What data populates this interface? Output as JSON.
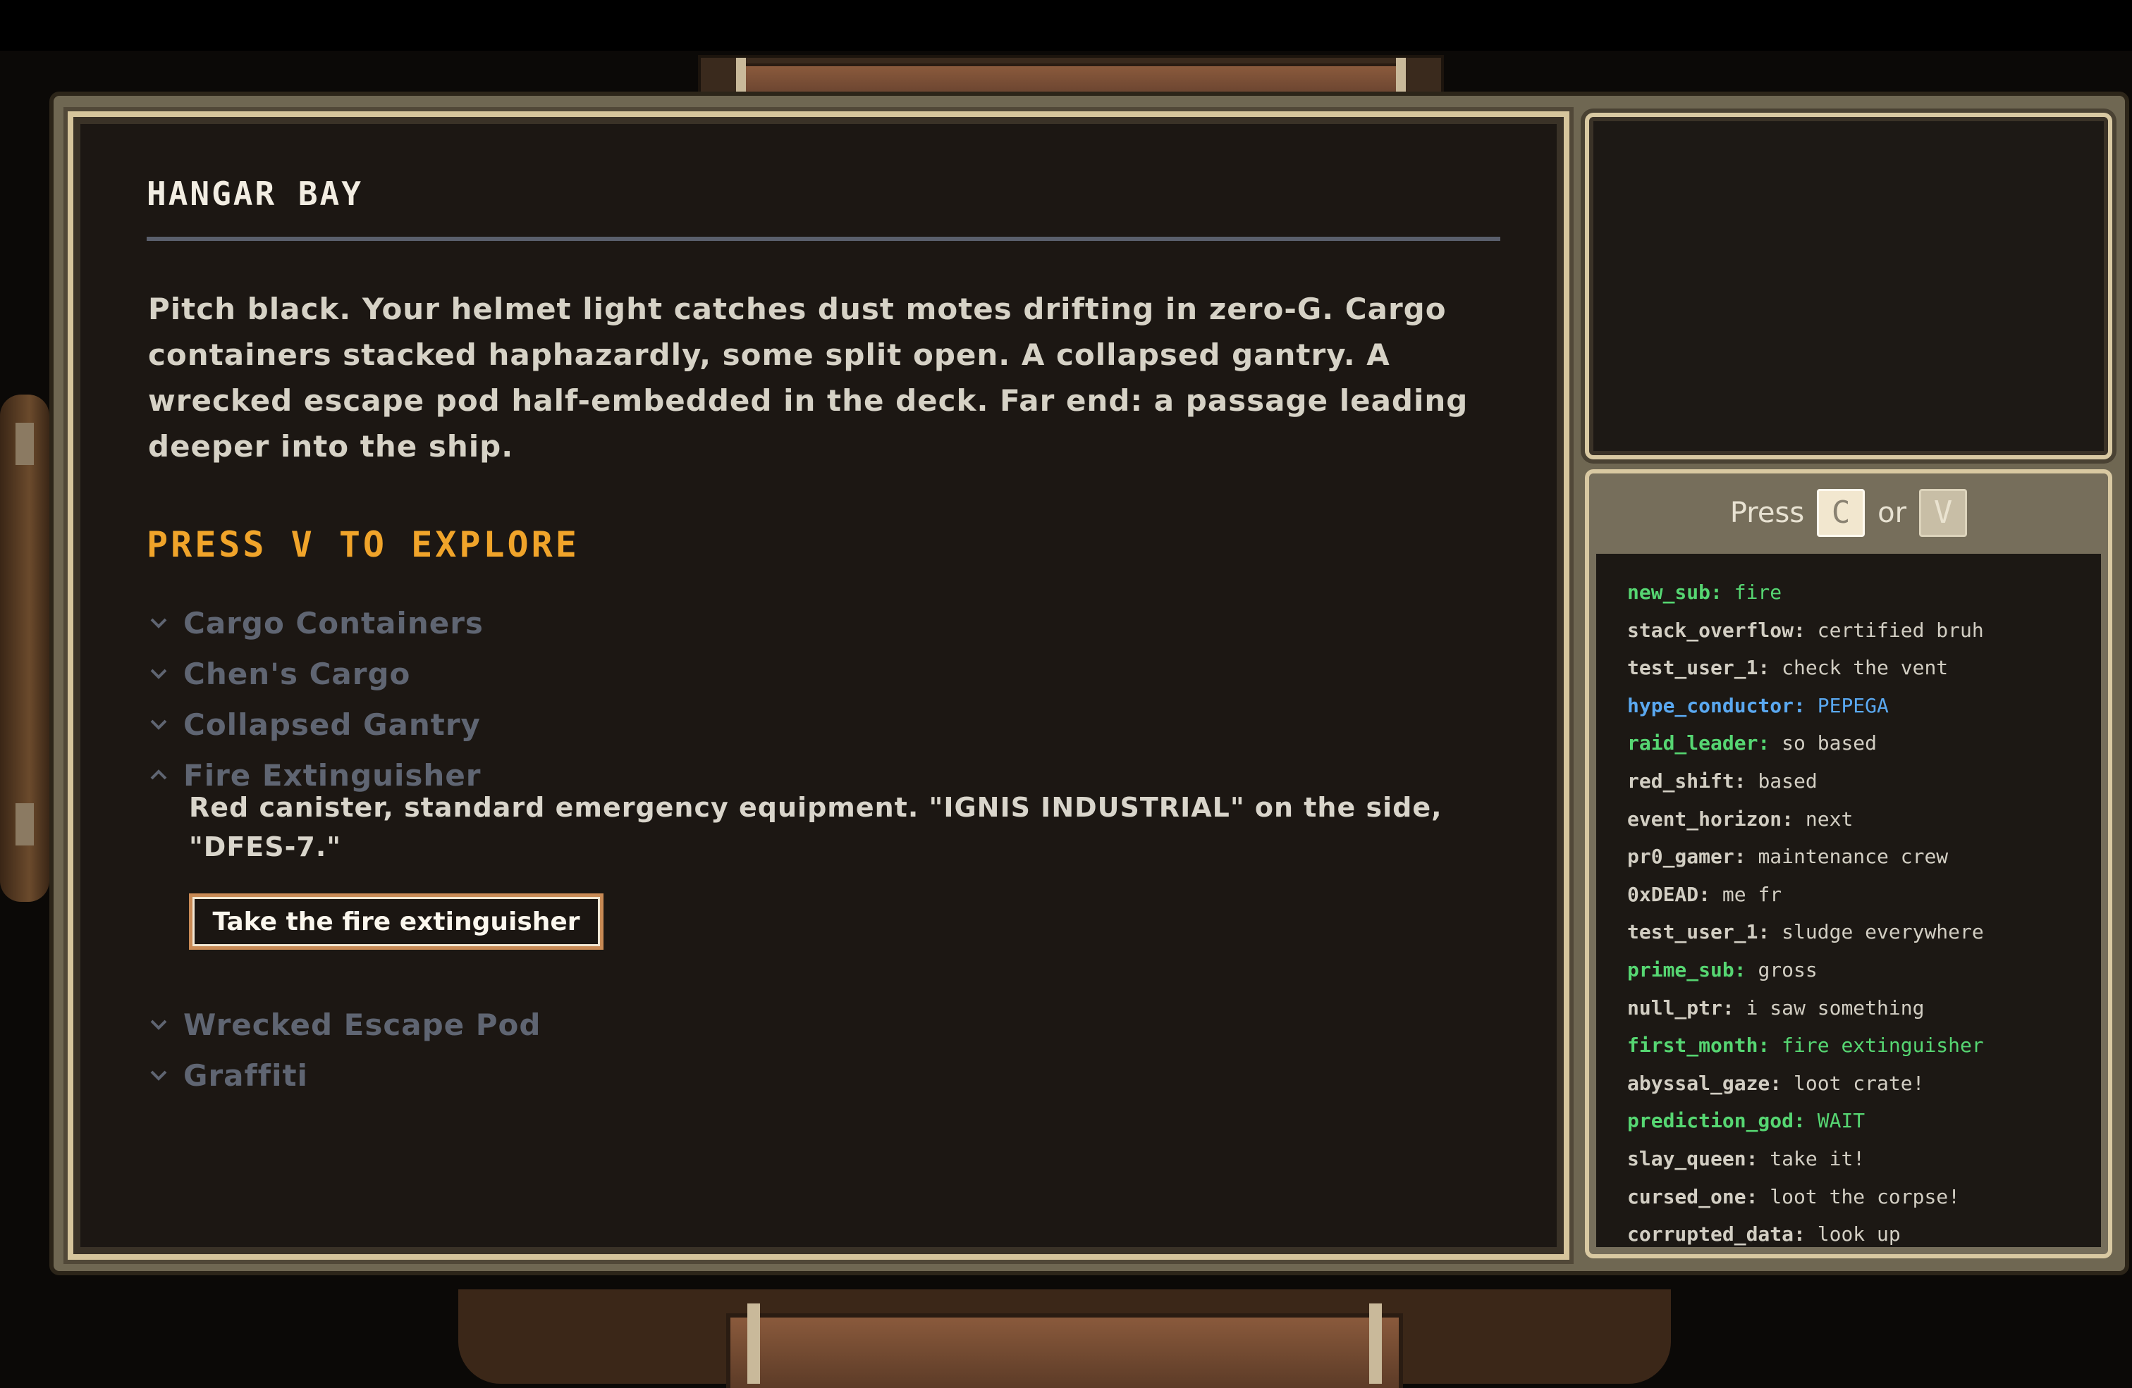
{
  "room": {
    "title": "HANGAR BAY",
    "description": "Pitch black. Your helmet light catches dust motes drifting in zero-G. Cargo containers stacked haphazardly, some split open. A collapsed gantry. A wrecked escape pod half-embedded in the deck. Far end: a passage leading deeper into the ship.",
    "explore_prompt": "PRESS V TO EXPLORE"
  },
  "points_of_interest": [
    {
      "label": "Cargo Containers",
      "expanded": false,
      "icon": "chevron-down-icon"
    },
    {
      "label": "Chen's Cargo",
      "expanded": false,
      "icon": "chevron-down-icon"
    },
    {
      "label": "Collapsed Gantry",
      "expanded": false,
      "icon": "chevron-down-icon"
    },
    {
      "label": "Fire Extinguisher",
      "expanded": true,
      "icon": "chevron-up-icon",
      "description": "Red canister, standard emergency equipment. \"IGNIS INDUSTRIAL\" on the side, \"DFES-7.\"",
      "action_label": "Take the fire extinguisher"
    },
    {
      "label": "Wrecked Escape Pod",
      "expanded": false,
      "icon": "chevron-down-icon"
    },
    {
      "label": "Graffiti",
      "expanded": false,
      "icon": "chevron-down-icon"
    }
  ],
  "chat": {
    "prompt_press": "Press",
    "key_c": "C",
    "prompt_or": "or",
    "key_v": "V",
    "messages": [
      {
        "user": "new_sub:",
        "text": "fire",
        "user_color": "#56d672",
        "text_color": "#56d672"
      },
      {
        "user": "stack_overflow:",
        "text": "certified bruh",
        "user_color": "#d2cec3",
        "text_color": "#d2cec3"
      },
      {
        "user": "test_user_1:",
        "text": "check the vent",
        "user_color": "#d2cec3",
        "text_color": "#d2cec3"
      },
      {
        "user": "hype_conductor:",
        "text": "PEPEGA",
        "user_color": "#5aa8f0",
        "text_color": "#5aa8f0"
      },
      {
        "user": "raid_leader:",
        "text": "so based",
        "user_color": "#56d672",
        "text_color": "#d2cec3"
      },
      {
        "user": "red_shift:",
        "text": "based",
        "user_color": "#d2cec3",
        "text_color": "#d2cec3"
      },
      {
        "user": "event_horizon:",
        "text": "next",
        "user_color": "#d2cec3",
        "text_color": "#d2cec3"
      },
      {
        "user": "pr0_gamer:",
        "text": "maintenance crew",
        "user_color": "#d2cec3",
        "text_color": "#d2cec3"
      },
      {
        "user": "0xDEAD:",
        "text": "me fr",
        "user_color": "#d2cec3",
        "text_color": "#d2cec3"
      },
      {
        "user": "test_user_1:",
        "text": "sludge everywhere",
        "user_color": "#d2cec3",
        "text_color": "#d2cec3"
      },
      {
        "user": "prime_sub:",
        "text": "gross",
        "user_color": "#56d672",
        "text_color": "#d2cec3"
      },
      {
        "user": "null_ptr:",
        "text": "i saw something",
        "user_color": "#d2cec3",
        "text_color": "#d2cec3"
      },
      {
        "user": "first_month:",
        "text": "fire extinguisher",
        "user_color": "#56d672",
        "text_color": "#56d672"
      },
      {
        "user": "abyssal_gaze:",
        "text": "loot crate!",
        "user_color": "#d2cec3",
        "text_color": "#d2cec3"
      },
      {
        "user": "prediction_god:",
        "text": "WAIT",
        "user_color": "#56d672",
        "text_color": "#56d672"
      },
      {
        "user": "slay_queen:",
        "text": "take it!",
        "user_color": "#d2cec3",
        "text_color": "#d2cec3"
      },
      {
        "user": "cursed_one:",
        "text": "loot the corpse!",
        "user_color": "#d2cec3",
        "text_color": "#d2cec3"
      },
      {
        "user": "corrupted_data:",
        "text": "look up",
        "user_color": "#d2cec3",
        "text_color": "#d2cec3"
      }
    ]
  }
}
